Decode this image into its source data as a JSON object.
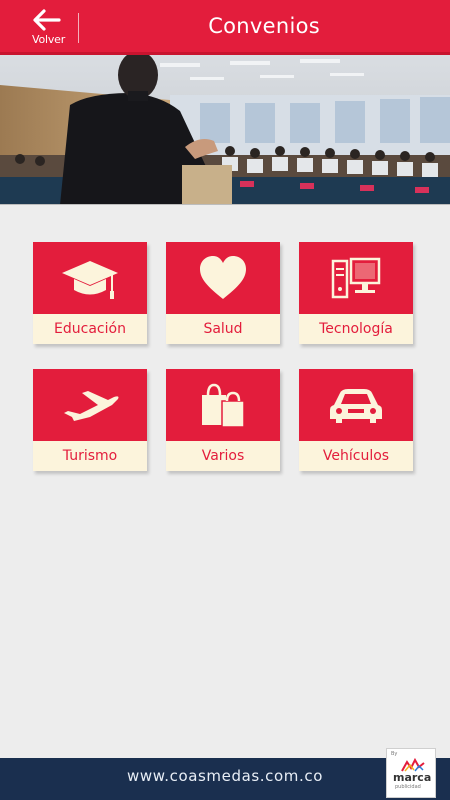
{
  "header": {
    "title": "Convenios",
    "back_label": "Volver"
  },
  "categories": [
    {
      "label": "Educación",
      "icon": "graduation-cap-icon"
    },
    {
      "label": "Salud",
      "icon": "heart-icon"
    },
    {
      "label": "Tecnología",
      "icon": "computer-icon"
    },
    {
      "label": "Turismo",
      "icon": "airplane-icon"
    },
    {
      "label": "Varios",
      "icon": "shopping-bags-icon"
    },
    {
      "label": "Vehículos",
      "icon": "car-icon"
    }
  ],
  "footer": {
    "url": "www.coasmedas.com.co",
    "logo": {
      "by": "By",
      "word": "marca",
      "sub": "publicidad"
    }
  },
  "colors": {
    "accent": "#e31d3c",
    "label_bg": "#fcf4dc",
    "footer_bg": "#1a2f4f"
  }
}
